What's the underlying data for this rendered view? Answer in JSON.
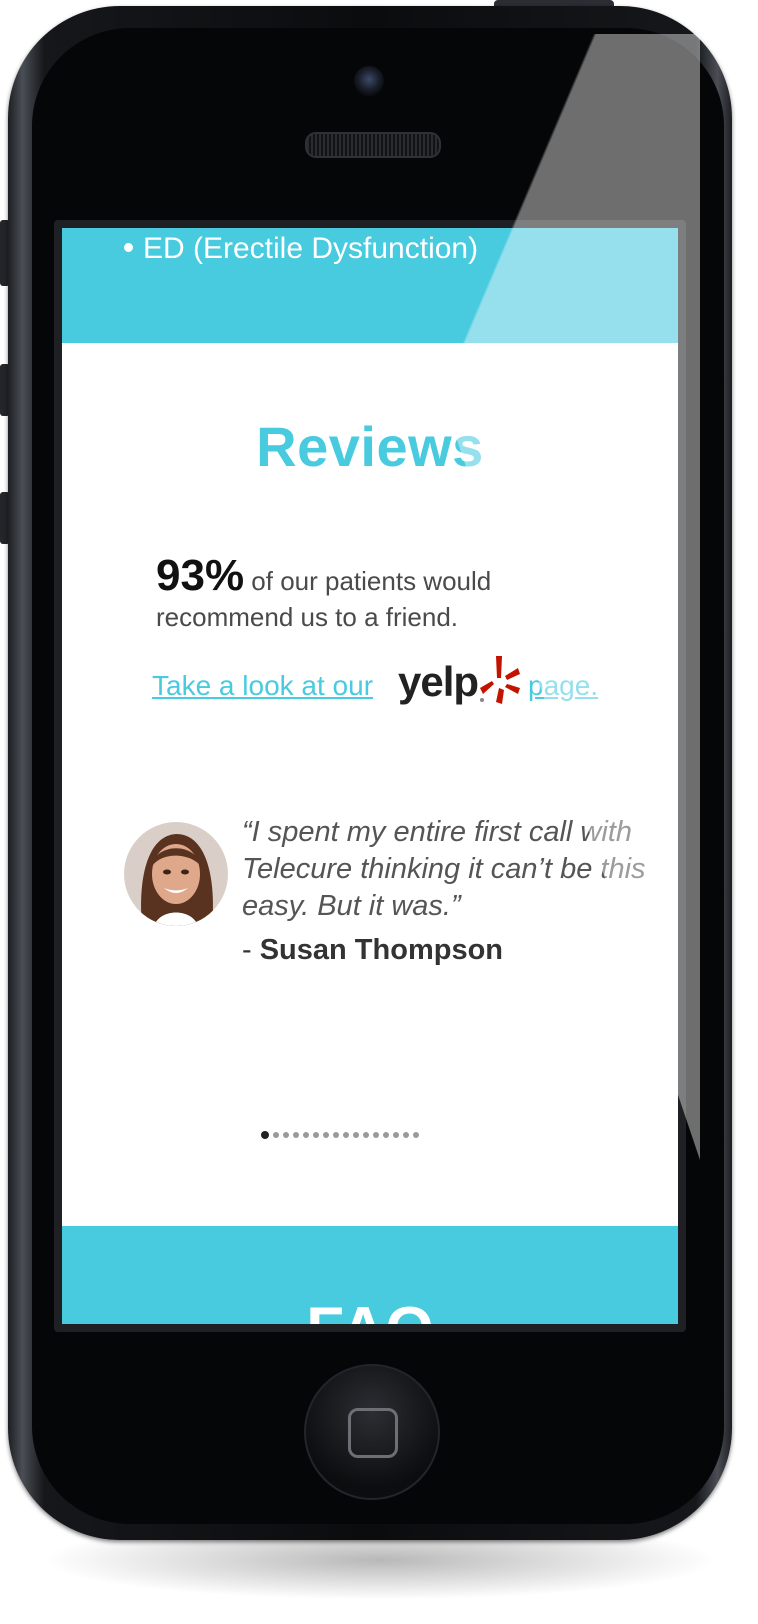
{
  "colors": {
    "accent": "#48cadf",
    "text_dark": "#111111",
    "text_muted": "#555555",
    "yelp_red": "#c41200"
  },
  "conditions": {
    "item": "ED (Erectile Dysfunction)"
  },
  "reviews": {
    "title": "Reviews",
    "stat_percent": "93%",
    "stat_text": " of our patients would recommend us to a friend.",
    "link_prefix": "Take a look at our",
    "yelp_word": "yelp",
    "link_suffix": "page.",
    "testimonial": {
      "quote": "“I spent my entire first call with Telecure thinking it can’t be this easy. But it was.”",
      "author_dash": "- ",
      "author_name": "Susan Thompson"
    },
    "pager": {
      "total": 16,
      "active": 1
    }
  },
  "faq": {
    "title": "FAQ"
  },
  "icons": {
    "yelp_burst": "yelp-burst-icon",
    "home": "home-button-icon"
  }
}
